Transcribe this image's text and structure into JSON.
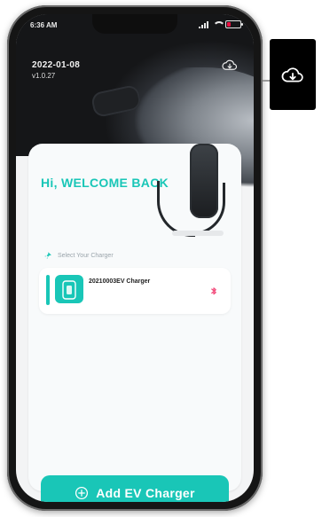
{
  "status_bar": {
    "time": "6:36 AM",
    "battery_fraction": 0.3
  },
  "header": {
    "date": "2022-01-08",
    "version": "v1.0.27",
    "download_icon": "cloud-download-icon"
  },
  "card": {
    "welcome": "Hi, WELCOME BACK",
    "select_label": "Select Your Charger",
    "chargers": [
      {
        "name": "20210003EV Charger",
        "connection_icon": "bluetooth-icon"
      }
    ]
  },
  "cta": {
    "label": "Add EV Charger",
    "icon": "plus-circle-icon",
    "color": "#19C6B7"
  },
  "colors": {
    "accent": "#19C6B7",
    "bluetooth": "#F24A7A"
  }
}
